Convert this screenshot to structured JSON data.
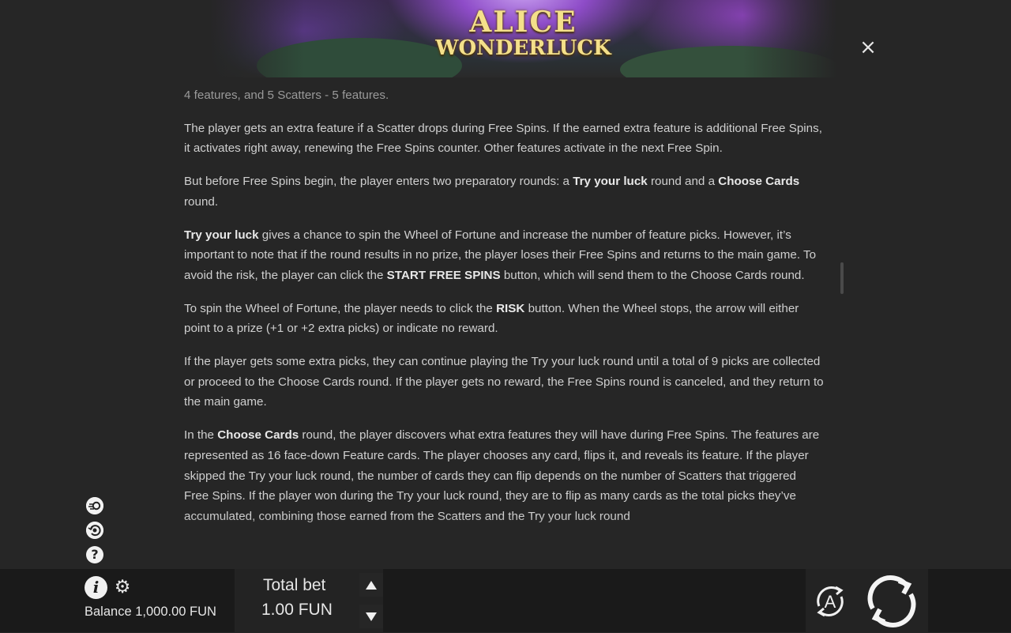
{
  "header": {
    "logo_line1": "ALICE",
    "logo_line2": "WONDERLUCK",
    "close_glyph": "×"
  },
  "article": {
    "paragraphs": [
      [
        {
          "t": "4 features, and 5 Scatters - 5 features."
        }
      ],
      [
        {
          "t": "The player gets an extra feature if a Scatter drops during Free Spins. If the earned extra feature is additional Free Spins, it activates right away, renewing the Free Spins counter. Other features activate in the next Free Spin."
        }
      ],
      [
        {
          "t": "But before Free Spins begin, the player enters two preparatory rounds: a "
        },
        {
          "t": "Try your luck",
          "b": true
        },
        {
          "t": " round and a "
        },
        {
          "t": "Choose Cards",
          "b": true
        },
        {
          "t": " round."
        }
      ],
      [
        {
          "t": "Try your luck",
          "b": true
        },
        {
          "t": " gives a chance to spin the Wheel of Fortune and increase the number of feature picks. However, it’s important to note that if the round results in no prize, the player loses their Free Spins and returns to the main game. To avoid the risk, the player can click the "
        },
        {
          "t": "START FREE SPINS",
          "b": true
        },
        {
          "t": " button, which will send them to the Choose Cards round."
        }
      ],
      [
        {
          "t": "To spin the Wheel of Fortune, the player needs to click the "
        },
        {
          "t": "RISK",
          "b": true
        },
        {
          "t": " button. When the Wheel stops, the arrow will either point to a prize (+1 or +2 extra picks) or indicate no reward."
        }
      ],
      [
        {
          "t": "If the player gets some extra picks, they can continue playing the Try your luck round until a total of 9 picks are collected or proceed to the Choose Cards round. If the player gets no reward, the Free Spins round is canceled, and they return to the main game."
        }
      ],
      [
        {
          "t": "In the "
        },
        {
          "t": "Choose Cards",
          "b": true
        },
        {
          "t": " round, the player discovers what extra features they will have during Free Spins. The features are represented as 16 face-down Feature cards. The player chooses any card, flips it, and reveals its feature. If the player skipped the Try your luck round, the number of cards they can flip depends on the number of Scatters that triggered Free Spins. If the player won during the Try your luck round, they are to flip as many cards as the total picks they’ve accumulated, combining those earned from the Scatters and the Try your luck round"
        }
      ]
    ]
  },
  "side_icons": [
    {
      "name": "turbo-icon",
      "glyph": "⚡"
    },
    {
      "name": "autoplay-history-icon",
      "glyph": "↻"
    },
    {
      "name": "help-icon",
      "glyph": "?"
    }
  ],
  "footer": {
    "info_glyph": "i",
    "gear_glyph": "⚙",
    "balance_label": "Balance",
    "balance_value": "1,000.00 FUN",
    "bet_label": "Total bet",
    "bet_value": "1.00 FUN",
    "auto_letter": "A"
  }
}
